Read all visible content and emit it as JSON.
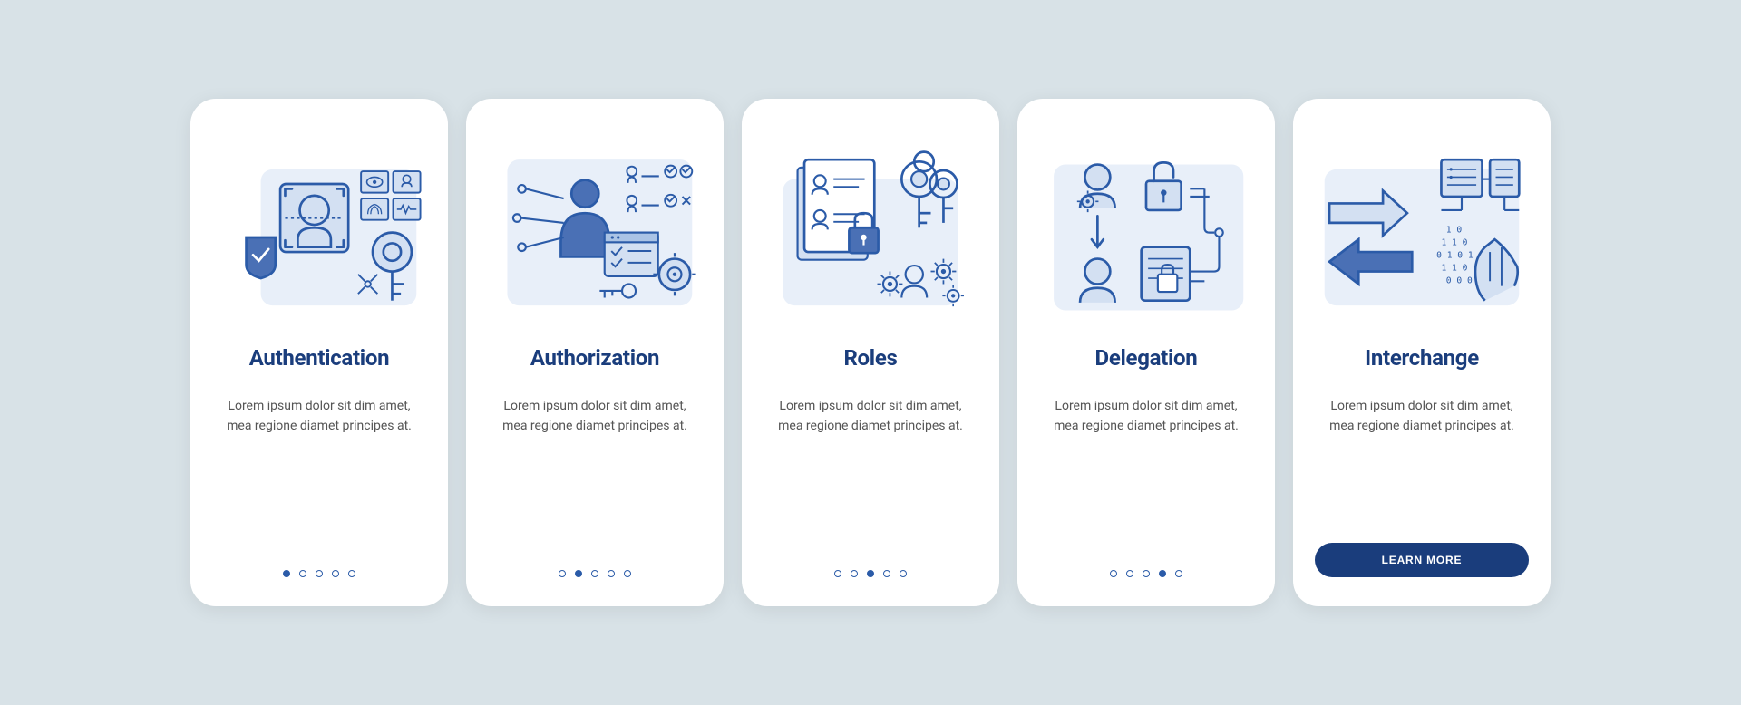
{
  "screens": [
    {
      "title": "Authentication",
      "desc": "Lorem ipsum dolor sit dim amet, mea regione diamet principes at.",
      "activeDot": 0,
      "hasButton": false
    },
    {
      "title": "Authorization",
      "desc": "Lorem ipsum dolor sit dim amet, mea regione diamet principes at.",
      "activeDot": 1,
      "hasButton": false
    },
    {
      "title": "Roles",
      "desc": "Lorem ipsum dolor sit dim amet, mea regione diamet principes at.",
      "activeDot": 2,
      "hasButton": false
    },
    {
      "title": "Delegation",
      "desc": "Lorem ipsum dolor sit dim amet, mea regione diamet principes at.",
      "activeDot": 3,
      "hasButton": false
    },
    {
      "title": "Interchange",
      "desc": "Lorem ipsum dolor sit dim amet, mea regione diamet principes at.",
      "activeDot": 4,
      "hasButton": true
    }
  ],
  "buttonLabel": "LEARN MORE",
  "colors": {
    "primary": "#1a3d7c",
    "accent": "#2b5ba8",
    "lightBlue": "#d3e0f2",
    "bgBlue": "#e8eff9"
  }
}
